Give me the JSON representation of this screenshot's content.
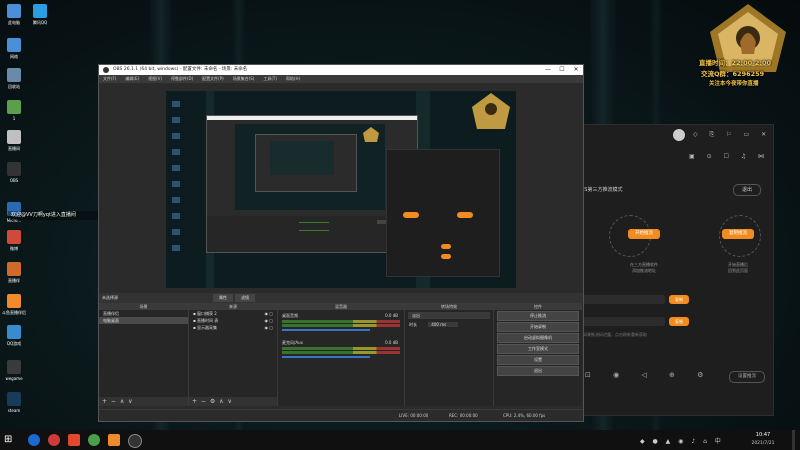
{
  "desktop": {
    "icons": [
      {
        "label": "此电脑",
        "color": "#4a8fd8"
      },
      {
        "label": "腾讯QQ",
        "color": "#2a9ee0"
      },
      {
        "label": "网络",
        "color": "#4a8fd8"
      },
      {
        "label": "回收站",
        "color": "#6a8aaa"
      },
      {
        "label": "1",
        "color": "#5aa04a"
      },
      {
        "label": "直播间",
        "color": "#c0c0c0"
      },
      {
        "label": "OBS",
        "color": "#333333"
      },
      {
        "label": "Micro...",
        "color": "#2a6ab0"
      },
      {
        "label": "微博",
        "color": "#d04a3a"
      },
      {
        "label": "直播伴",
        "color": "#d06a2a"
      },
      {
        "label": "斗鱼直播伴侣",
        "color": "#f08a2a"
      },
      {
        "label": "QQ游戏",
        "color": "#3a8ad0"
      },
      {
        "label": "wegame",
        "color": "#3a3a3a"
      },
      {
        "label": "steam",
        "color": "#1a3a5a"
      }
    ],
    "marquee": "欢迎@VV刀啊yqt进入直播间"
  },
  "overlay": {
    "line1": "直播时间：22:00-2:00",
    "line2": "交流Q群：6296259",
    "line3": "关注本今夜带你直播"
  },
  "obs": {
    "title": "OBS 26.1.1 (64 bit, windows) - 配置文件: 未命名 - 场景: 未命名",
    "window_controls": [
      "—",
      "☐",
      "✕"
    ],
    "menu": [
      "文件(F)",
      "编辑(E)",
      "视图(V)",
      "停靠部件(D)",
      "配置文件(P)",
      "场景集合(S)",
      "工具(T)",
      "帮助(H)"
    ],
    "source_label": "未选择源",
    "props_label": "属性",
    "filters_label": "滤镜",
    "docks": {
      "scenes": {
        "title": "场景",
        "items": [
          "直播伴侣",
          "电脑桌面"
        ],
        "selected": 1
      },
      "sources": {
        "title": "来源",
        "items": [
          "窗口捕获 2",
          "直播时间 表",
          "显示器采集"
        ]
      },
      "mixer": {
        "title": "混音器",
        "channels": [
          {
            "name": "桌面音频",
            "db": "0.0 dB"
          },
          {
            "name": "麦克风/Aux",
            "db": "0.0 dB"
          }
        ]
      },
      "transitions": {
        "title": "转场特效",
        "type": "淡出",
        "duration_label": "时长",
        "duration": "400 ms"
      },
      "controls": {
        "title": "控件",
        "buttons": [
          "停止推流",
          "开始录制",
          "启动虚拟摄像机",
          "工作室模式",
          "设置",
          "退出"
        ]
      }
    },
    "status": {
      "live_label": "LIVE:",
      "live_time": "00:00:00",
      "rec_label": "REC:",
      "rec_time": "00:00:00",
      "cpu": "CPU: 2.4%, 60.00 fps"
    }
  },
  "right_app": {
    "mode_text": "OBS第三方推流模式",
    "exit_label": "退出",
    "step_buttons": [
      "开始推流",
      "复制推流"
    ],
    "step_labels": [
      "在三方直播软件\n添加推流地址",
      "开始直播后\n回到此页面"
    ],
    "field_button": "复制",
    "note": "如果推流码泄露，点击刷新重新获取",
    "bottom_btn": "设置推流"
  },
  "taskbar": {
    "time": "10:47",
    "date": "2021/7/21"
  },
  "colors": {
    "accent": "#f28c1f",
    "obs_bg": "#2b2b2b",
    "overlay_gold": "#f4c64a"
  }
}
